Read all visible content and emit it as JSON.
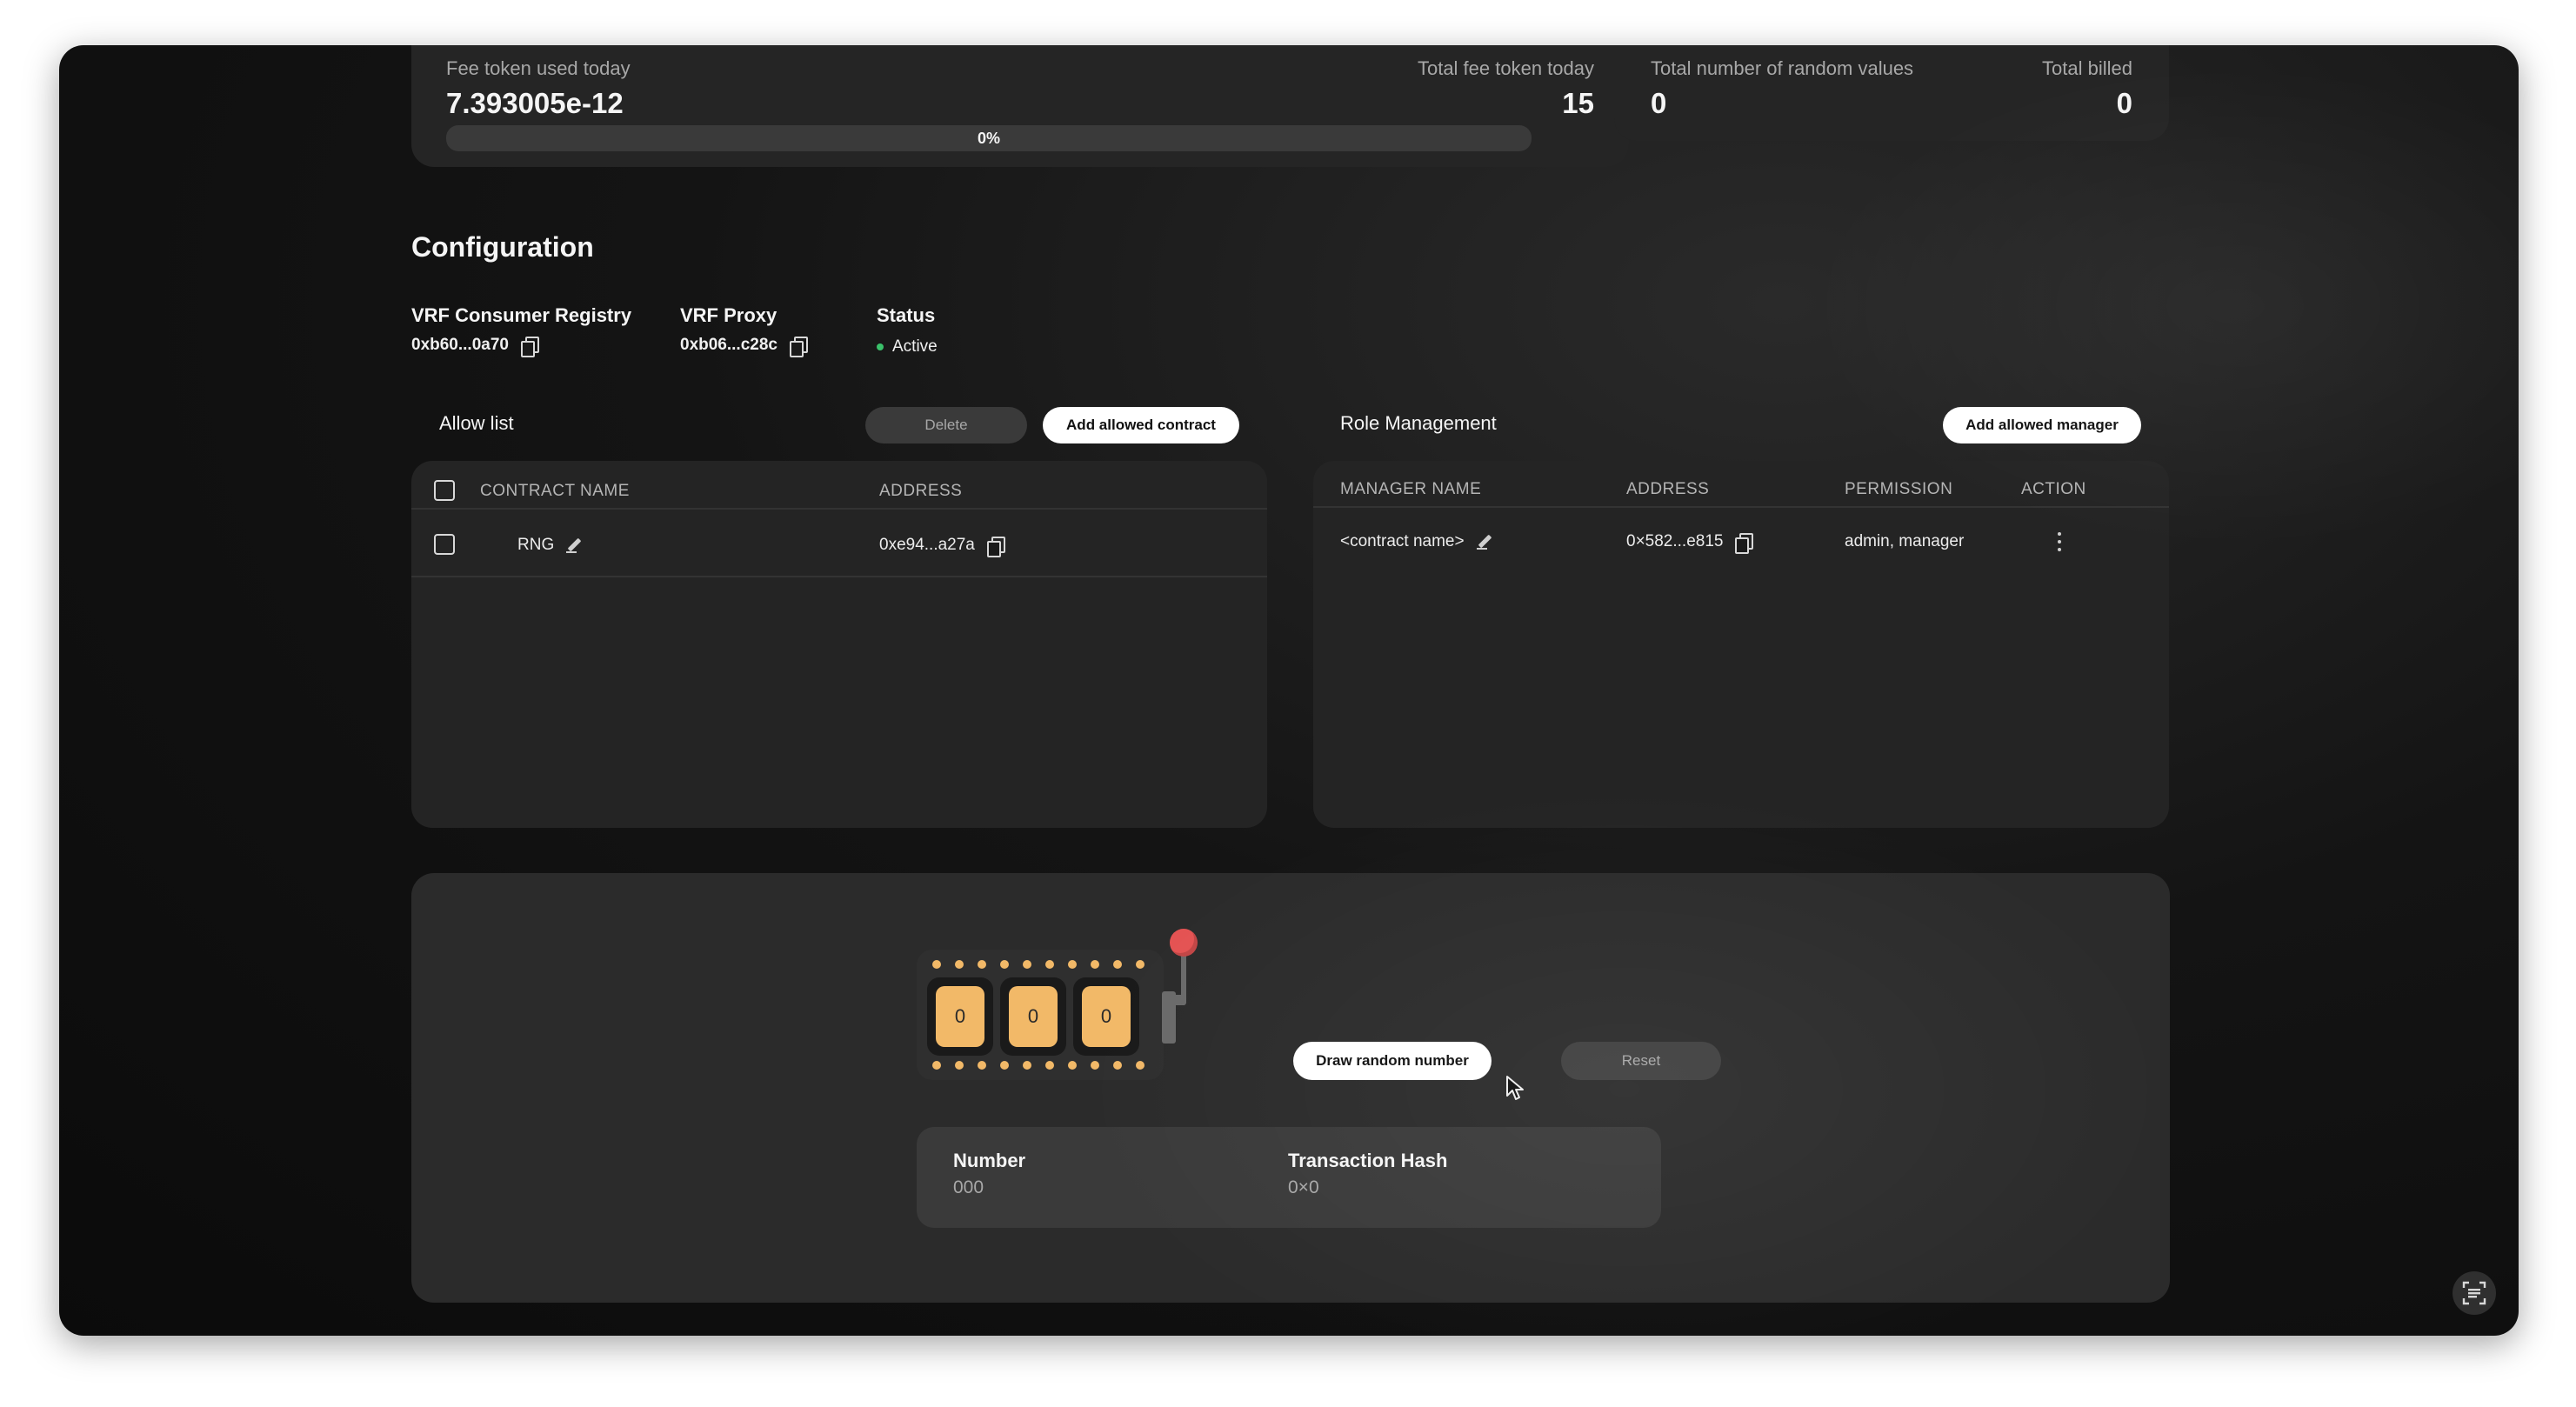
{
  "stats": {
    "fee_token_used_label": "Fee token used today",
    "fee_token_used_value": "7.393005e-12",
    "total_fee_label": "Total fee token today",
    "total_fee_value": "15",
    "progress_text": "0%",
    "progress_fraction": 0.0,
    "random_values_label": "Total number of random values",
    "random_values_value": "0",
    "total_billed_label": "Total billed",
    "total_billed_value": "0"
  },
  "config": {
    "title": "Configuration",
    "registry_label": "VRF Consumer Registry",
    "registry_value": "0xb60...0a70",
    "proxy_label": "VRF Proxy",
    "proxy_value": "0xb06...c28c",
    "status_label": "Status",
    "status_value": "Active"
  },
  "allow_list": {
    "title": "Allow list",
    "delete_label": "Delete",
    "add_label": "Add allowed contract",
    "columns": [
      "CONTRACT NAME",
      "ADDRESS"
    ],
    "rows": [
      {
        "name": "RNG",
        "address": "0xe94...a27a"
      }
    ]
  },
  "roles": {
    "title": "Role Management",
    "add_label": "Add allowed manager",
    "columns": [
      "MANAGER NAME",
      "ADDRESS",
      "PERMISSION",
      "ACTION"
    ],
    "rows": [
      {
        "name": "<contract name>",
        "address": "0×582...e815",
        "permission": "admin, manager"
      }
    ]
  },
  "draw": {
    "reels": [
      "0",
      "0",
      "0"
    ],
    "draw_label": "Draw random number",
    "reset_label": "Reset",
    "number_label": "Number",
    "number_value": "000",
    "hash_label": "Transaction Hash",
    "hash_value": "0×0"
  },
  "colors": {
    "accent_reel": "#f2b968",
    "lever": "#e45353",
    "status_active": "#3ac16a"
  }
}
